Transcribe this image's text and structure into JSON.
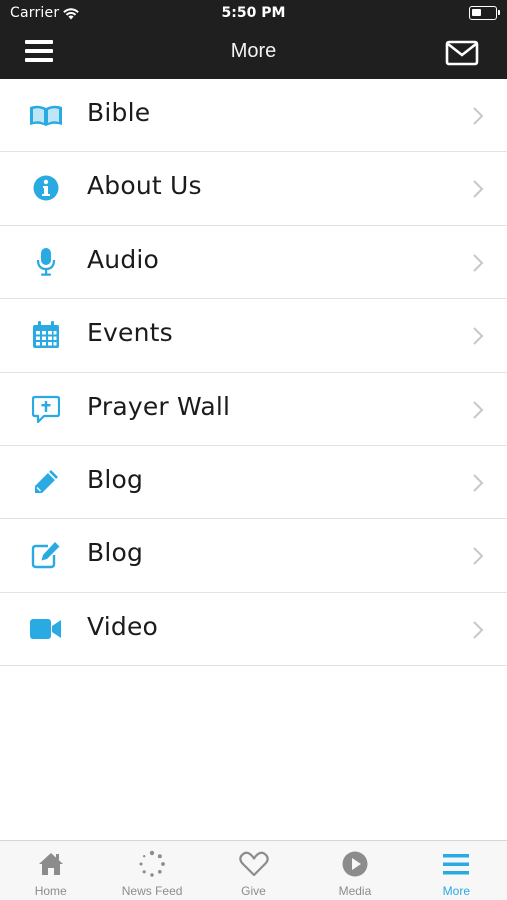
{
  "status_bar": {
    "carrier": "Carrier",
    "time": "5:50 PM",
    "battery_level": 0.45
  },
  "nav": {
    "title": "More",
    "menu_icon": "hamburger-icon",
    "mail_icon": "envelope-icon"
  },
  "colors": {
    "accent": "#2aaae2",
    "topbar": "#1f1f1f",
    "tab_inactive": "#8c8c8c"
  },
  "menu": {
    "items": [
      {
        "label": "Bible",
        "icon": "bible-icon"
      },
      {
        "label": "About Us",
        "icon": "info-icon"
      },
      {
        "label": "Audio",
        "icon": "microphone-icon"
      },
      {
        "label": "Events",
        "icon": "calendar-icon"
      },
      {
        "label": "Prayer Wall",
        "icon": "prayer-bubble-icon"
      },
      {
        "label": "Blog",
        "icon": "pencil-icon"
      },
      {
        "label": "Blog",
        "icon": "edit-icon"
      },
      {
        "label": "Video",
        "icon": "video-camera-icon"
      }
    ]
  },
  "tabs": [
    {
      "label": "Home",
      "icon": "home-icon",
      "active": false
    },
    {
      "label": "News Feed",
      "icon": "refresh-icon",
      "active": false
    },
    {
      "label": "Give",
      "icon": "heart-icon",
      "active": false
    },
    {
      "label": "Media",
      "icon": "play-icon",
      "active": false
    },
    {
      "label": "More",
      "icon": "menu-icon",
      "active": true
    }
  ]
}
